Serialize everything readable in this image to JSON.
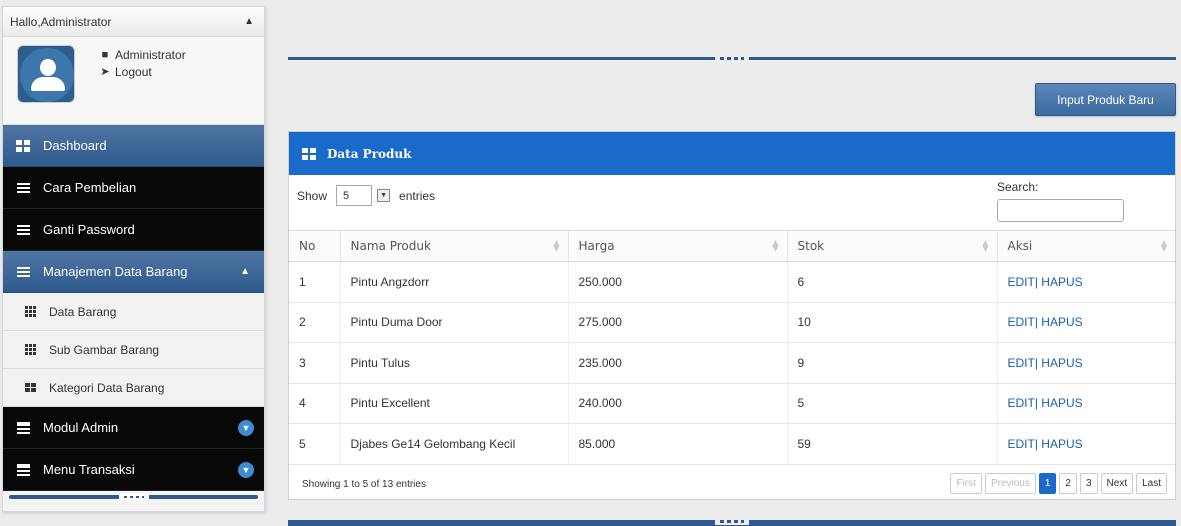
{
  "sidebar": {
    "greeting": "Hallo,Administrator",
    "user": {
      "name": "Administrator",
      "logout": "Logout"
    },
    "menu": [
      {
        "label": "Dashboard"
      },
      {
        "label": "Cara Pembelian"
      },
      {
        "label": "Ganti Password"
      },
      {
        "label": "Manajemen Data Barang"
      },
      {
        "label": "Modul Admin"
      },
      {
        "label": "Menu Transaksi"
      }
    ],
    "submenu": [
      {
        "label": "Data Barang"
      },
      {
        "label": "Sub Gambar Barang"
      },
      {
        "label": "Kategori Data Barang"
      }
    ]
  },
  "main": {
    "input_button": "Input Produk Baru",
    "panel_title": "Data Produk",
    "show_label": "Show",
    "entries_value": "5",
    "entries_label": "entries",
    "search_label": "Search:",
    "columns": [
      "No",
      "Nama Produk",
      "Harga",
      "Stok",
      "Aksi"
    ],
    "rows": [
      {
        "no": "1",
        "nama": "Pintu Angzdorr",
        "harga": "250.000",
        "stok": "6",
        "aksi": "EDIT| HAPUS"
      },
      {
        "no": "2",
        "nama": "Pintu Duma Door",
        "harga": "275.000",
        "stok": "10",
        "aksi": "EDIT| HAPUS"
      },
      {
        "no": "3",
        "nama": "Pintu Tulus",
        "harga": "235.000",
        "stok": "9",
        "aksi": "EDIT| HAPUS"
      },
      {
        "no": "4",
        "nama": "Pintu Excellent",
        "harga": "240.000",
        "stok": "5",
        "aksi": "EDIT| HAPUS"
      },
      {
        "no": "5",
        "nama": "Djabes Ge14 Gelombang Kecil",
        "harga": "85.000",
        "stok": "59",
        "aksi": "EDIT| HAPUS"
      }
    ],
    "info": "Showing 1 to 5 of 13 entries",
    "pager": {
      "first": "First",
      "previous": "Previous",
      "pages": [
        "1",
        "2",
        "3"
      ],
      "next": "Next",
      "last": "Last"
    }
  },
  "colors": {
    "accent_blue": "#1a6ac9",
    "nav_blue": "#2f5a8d",
    "nav_black": "#080808"
  }
}
